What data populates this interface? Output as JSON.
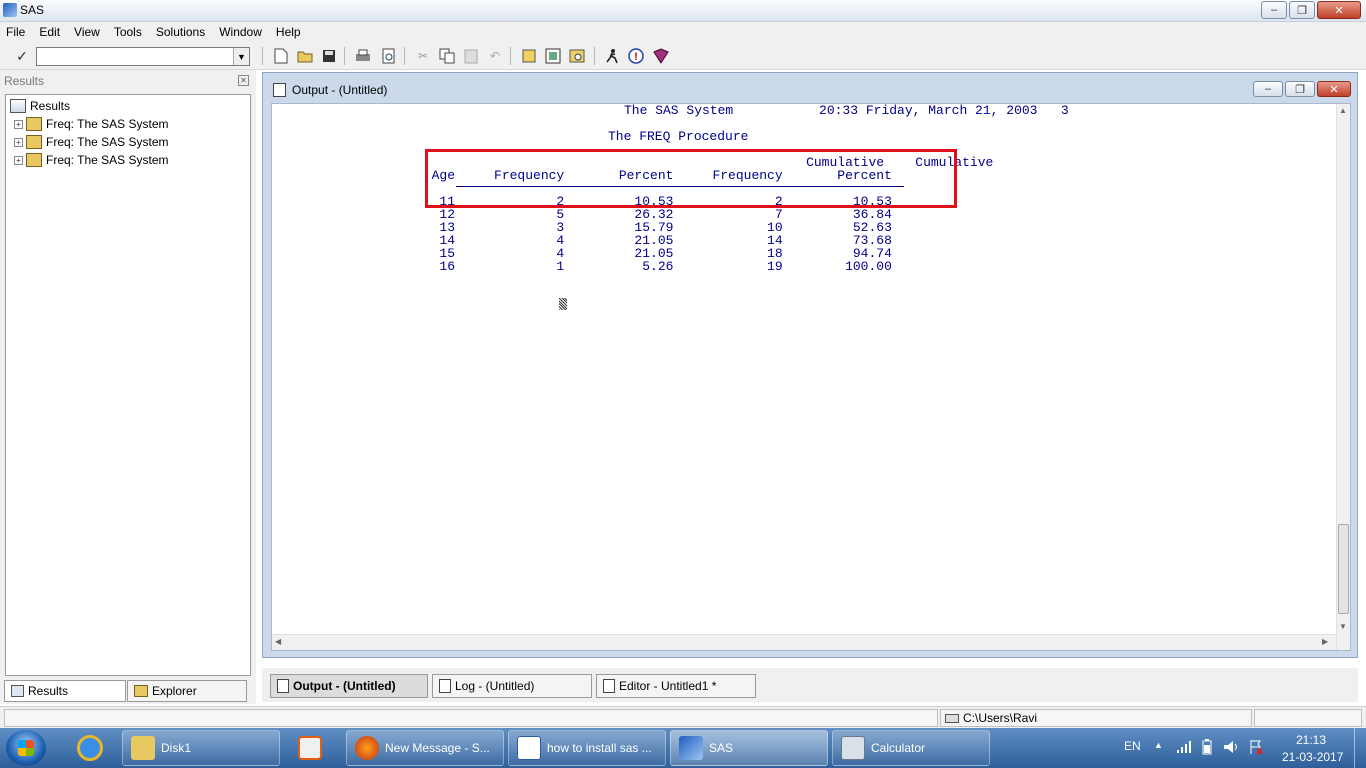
{
  "titlebar": {
    "title": "SAS"
  },
  "menu": [
    "File",
    "Edit",
    "View",
    "Tools",
    "Solutions",
    "Window",
    "Help"
  ],
  "command_box": {
    "value": ""
  },
  "results_panel": {
    "header": "Results",
    "root": "Results",
    "items": [
      {
        "label": "Freq:  The SAS System"
      },
      {
        "label": "Freq:  The SAS System"
      },
      {
        "label": "Freq:  The SAS System"
      }
    ],
    "tabs": {
      "results": "Results",
      "explorer": "Explorer"
    }
  },
  "output_window": {
    "title": "Output - (Untitled)",
    "header_line": "The SAS System           20:33 Friday, March 21, 2003   3",
    "procedure": "The FREQ Procedure",
    "columns": [
      "                                                  Cumulative    Cumulative",
      "  Age     Frequency       Percent     Frequency       Percent"
    ],
    "rows": [
      "   11             2         10.53             2         10.53",
      "   12             5         26.32             7         36.84",
      "   13             3         15.79            10         52.63",
      "   14             4         21.05            14         73.68",
      "   15             4         21.05            18         94.74",
      "   16             1          5.26            19        100.00"
    ],
    "highlight_color": "#e0101a"
  },
  "window_tabs": {
    "output": "Output - (Untitled)",
    "log": "Log - (Untitled)",
    "editor": "Editor - Untitled1 *"
  },
  "status_bar": {
    "path": "C:\\Users\\Ravi"
  },
  "taskbar": {
    "items": [
      {
        "label": "Disk1"
      },
      {
        "label": "New Message - S..."
      },
      {
        "label": "how to install sas ..."
      },
      {
        "label": "SAS"
      },
      {
        "label": "Calculator"
      }
    ],
    "language": "EN",
    "time": "21:13",
    "date": "21-03-2017"
  }
}
